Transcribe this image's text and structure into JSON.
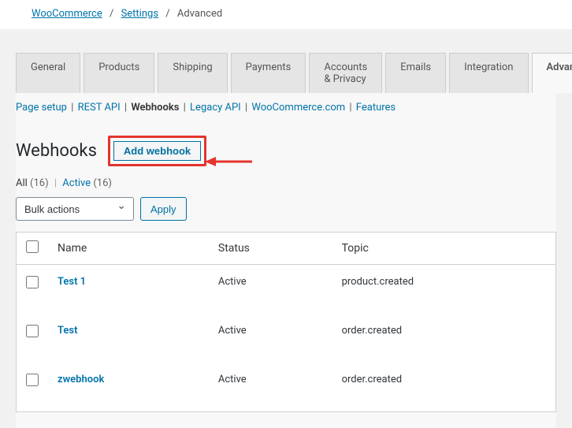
{
  "breadcrumb": {
    "wc": "WooCommerce",
    "settings": "Settings",
    "current": "Advanced"
  },
  "tabs": [
    "General",
    "Products",
    "Shipping",
    "Payments",
    "Accounts & Privacy",
    "Emails",
    "Integration",
    "Advanced"
  ],
  "subnav": {
    "page_setup": "Page setup",
    "rest_api": "REST API",
    "webhooks": "Webhooks",
    "legacy_api": "Legacy API",
    "wc_com": "WooCommerce.com",
    "features": "Features"
  },
  "heading": "Webhooks",
  "add_btn": "Add webhook",
  "filters": {
    "all_label": "All",
    "all_count": "(16)",
    "active_label": "Active",
    "active_count": "(16)"
  },
  "bulk_actions": "Bulk actions",
  "apply": "Apply",
  "columns": {
    "name": "Name",
    "status": "Status",
    "topic": "Topic"
  },
  "rows": [
    {
      "name": "Test 1",
      "status": "Active",
      "topic": "product.created"
    },
    {
      "name": "Test",
      "status": "Active",
      "topic": "order.created"
    },
    {
      "name": "zwebhook",
      "status": "Active",
      "topic": "order.created"
    }
  ]
}
